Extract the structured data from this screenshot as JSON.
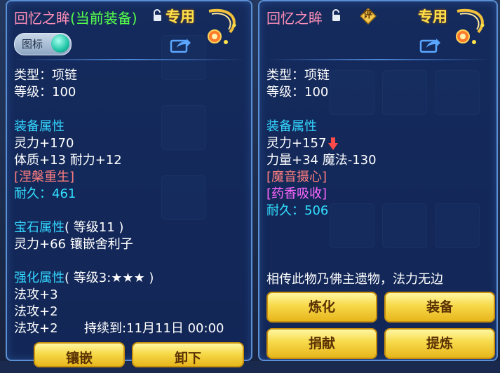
{
  "left_panel": {
    "title": "回忆之眸",
    "current_tag": "(当前装备)",
    "special": "专用",
    "toggle_label": "图标",
    "type": "类型：项链",
    "level": "等级：100",
    "equip_attr_header": "装备属性",
    "attr_spirit": "灵力+170",
    "attr_body_str": "体质+13 耐力+12",
    "special_skill": "[涅槃重生]",
    "durability_label": "耐久：",
    "durability_value": "461",
    "gem_header": "宝石属性",
    "gem_level": "( 等级11 )",
    "gem_attr": "灵力+66 镶嵌舍利子",
    "enhance_header": "强化属性",
    "enhance_level": "( 等级3:★★★ )",
    "enhance_1": "法攻+3",
    "enhance_2": "法攻+2",
    "enhance_3": "法攻+2",
    "enhance_duration": "持续到:11月11日 00:00",
    "buttons": [
      "镶嵌",
      "卸下"
    ]
  },
  "right_panel": {
    "title": "回忆之眸",
    "rate_label": "评",
    "special": "专用",
    "type": "类型：项链",
    "level": "等级：100",
    "equip_attr_header": "装备属性",
    "attr_spirit": "灵力+157",
    "attr_str_magic": "力量+34 魔法-130",
    "special_skill_1": "[魔音摄心]",
    "special_skill_2": "[药香吸收]",
    "durability_label": "耐久：",
    "durability_value": "506",
    "description": "相传此物乃佛主遗物，法力无边",
    "buttons": [
      "炼化",
      "装备",
      "捐献",
      "提炼"
    ]
  },
  "colors": {
    "title": "#ff8fb8",
    "current_tag": "#55ff4a",
    "label": "#33d6ff",
    "special": "#ffe24a",
    "skill_red": "#ff7e7e",
    "skill_magenta": "#ff66ff",
    "down_arrow": "#ff4a4a"
  }
}
